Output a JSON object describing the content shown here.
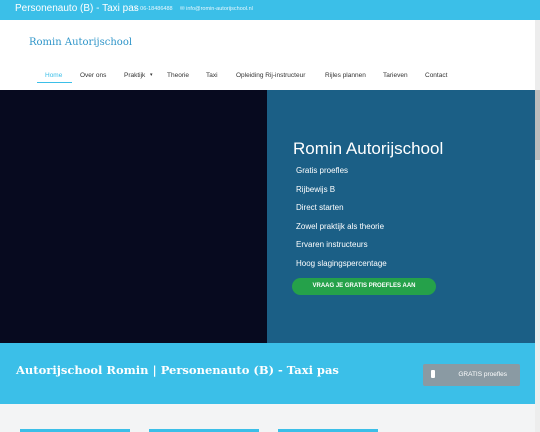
{
  "topbar": {
    "title": "Personenauto (B) - Taxi pas",
    "phone": "06-18486488",
    "email": "info@romin-autorijschool.nl"
  },
  "brand": "Romin Autorijschool",
  "nav": [
    "Home",
    "Over ons",
    "Praktijk",
    "Theorie",
    "Taxi",
    "Opleiding Rij-instructeur",
    "Rijles plannen",
    "Tarieven",
    "Contact"
  ],
  "hero": {
    "title": "Romin Autorijschool",
    "bullets": [
      "Gratis proefles",
      "Rijbewijs B",
      "Direct starten",
      "Zowel praktijk als theorie",
      "Ervaren instructeurs",
      "Hoog slagingspercentage"
    ],
    "cta": "VRAAG JE GRATIS PROEFLES AAN"
  },
  "band": {
    "title": "Autorijschool Romin | Personenauto (B) - Taxi pas",
    "button": "GRATIS proefles"
  },
  "colors": {
    "accent": "#3bbfe8",
    "hero_dark": "#070a1f",
    "hero_blue": "#1b5f86",
    "cta_green": "#25a14a"
  }
}
